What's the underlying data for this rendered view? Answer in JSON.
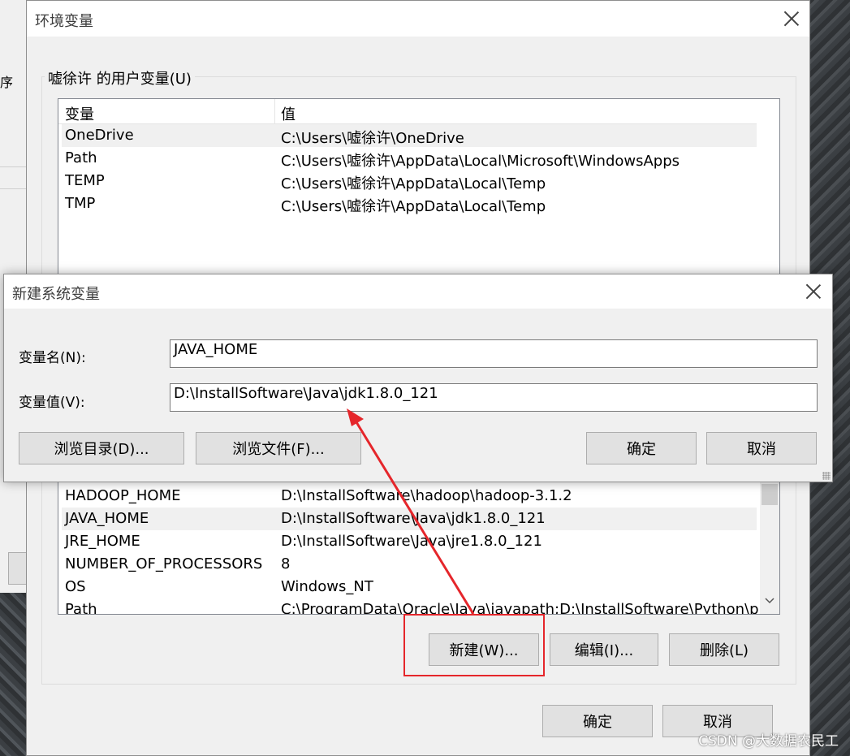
{
  "background": {
    "left_fragment": "序"
  },
  "env_window": {
    "title": "环境变量",
    "user_group_label": "嘘徐许 的用户变量(U)",
    "user_columns": [
      "变量",
      "值"
    ],
    "user_rows": [
      {
        "name": "OneDrive",
        "value": "C:\\Users\\嘘徐许\\OneDrive"
      },
      {
        "name": "Path",
        "value": "C:\\Users\\嘘徐许\\AppData\\Local\\Microsoft\\WindowsApps"
      },
      {
        "name": "TEMP",
        "value": "C:\\Users\\嘘徐许\\AppData\\Local\\Temp"
      },
      {
        "name": "TMP",
        "value": "C:\\Users\\嘘徐许\\AppData\\Local\\Temp"
      }
    ],
    "system_rows": [
      {
        "name": "HADOOP_HOME",
        "value": "D:\\InstallSoftware\\hadoop\\hadoop-3.1.2"
      },
      {
        "name": "JAVA_HOME",
        "value": "D:\\InstallSoftware\\Java\\jdk1.8.0_121"
      },
      {
        "name": "JRE_HOME",
        "value": "D:\\InstallSoftware\\Java\\jre1.8.0_121"
      },
      {
        "name": "NUMBER_OF_PROCESSORS",
        "value": "8"
      },
      {
        "name": "OS",
        "value": "Windows_NT"
      },
      {
        "name": "Path",
        "value": "C:\\ProgramData\\Oracle\\Java\\javapath;D:\\InstallSoftware\\Python\\p"
      }
    ],
    "system_buttons": {
      "new": "新建(W)...",
      "edit": "编辑(I)...",
      "delete": "删除(L)"
    },
    "ok": "确定",
    "cancel": "取消"
  },
  "new_dialog": {
    "title": "新建系统变量",
    "name_label": "变量名(N):",
    "name_value": "JAVA_HOME",
    "value_label": "变量值(V):",
    "value_value": "D:\\InstallSoftware\\Java\\jdk1.8.0_121",
    "browse_dir": "浏览目录(D)...",
    "browse_file": "浏览文件(F)...",
    "ok": "确定",
    "cancel": "取消"
  },
  "annotation": {
    "color": "#e5262b"
  },
  "watermark": "CSDN @大数据农民工"
}
